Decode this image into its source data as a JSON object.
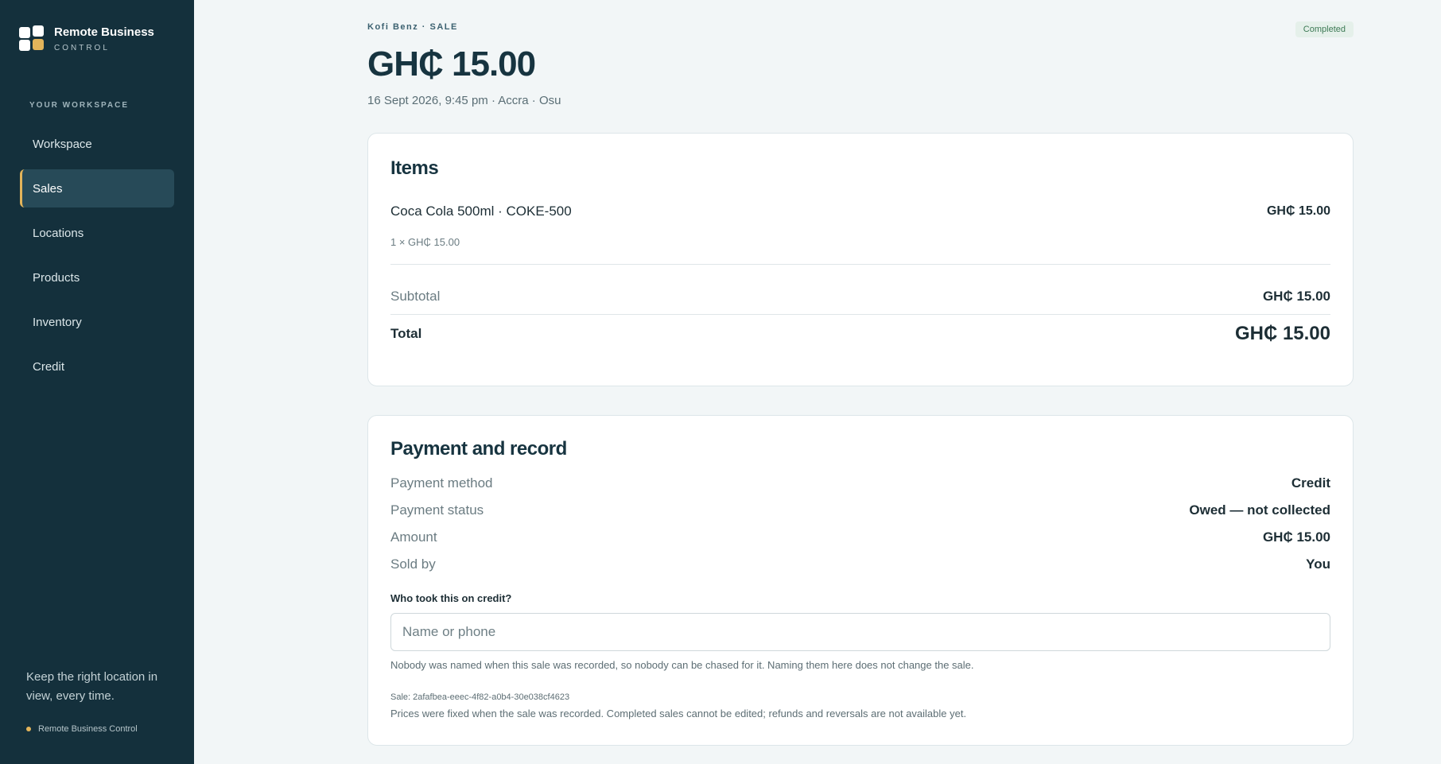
{
  "sidebar": {
    "brand_name": "Remote Business",
    "brand_sub": "CONTROL",
    "section_label": "YOUR WORKSPACE",
    "items": [
      {
        "label": "Workspace"
      },
      {
        "label": "Sales"
      },
      {
        "label": "Locations"
      },
      {
        "label": "Products"
      },
      {
        "label": "Inventory"
      },
      {
        "label": "Credit"
      }
    ],
    "active_item": "Sales",
    "tagline": "Keep the right location in view, every time.",
    "footer": "Remote Business Control"
  },
  "header": {
    "crumb": "Kofi Benz · SALE",
    "status": "Completed",
    "amount": "GH₵ 15.00",
    "meta": "16 Sept 2026, 9:45 pm · Accra · Osu"
  },
  "items_card": {
    "title": "Items",
    "item": {
      "name": "Coca Cola 500ml · COKE-500",
      "qty_line": "1 × GH₵ 15.00",
      "price": "GH₵ 15.00"
    },
    "subtotal_label": "Subtotal",
    "subtotal_value": "GH₵ 15.00",
    "total_label": "Total",
    "total_value": "GH₵ 15.00"
  },
  "payment_card": {
    "title": "Payment and record",
    "rows": [
      {
        "label": "Payment method",
        "value": "Credit"
      },
      {
        "label": "Payment status",
        "value": "Owed — not collected"
      },
      {
        "label": "Amount",
        "value": "GH₵ 15.00"
      },
      {
        "label": "Sold by",
        "value": "You"
      }
    ],
    "question": "Who took this on credit?",
    "input_placeholder": "Name or phone",
    "input_value": "",
    "help": "Nobody was named when this sale was recorded, so nobody can be chased for it. Naming them here does not change the sale.",
    "sale_id": "Sale: 2afafbea-eeec-4f82-a0b4-30e038cf4623",
    "note": "Prices were fixed when the sale was recorded. Completed sales cannot be edited; refunds and reversals are not available yet."
  },
  "colors": {
    "sidebar_bg": "#14303c",
    "accent": "#e3b45a",
    "page_bg": "#f2f6f7",
    "status_green": "#3d7a55"
  }
}
